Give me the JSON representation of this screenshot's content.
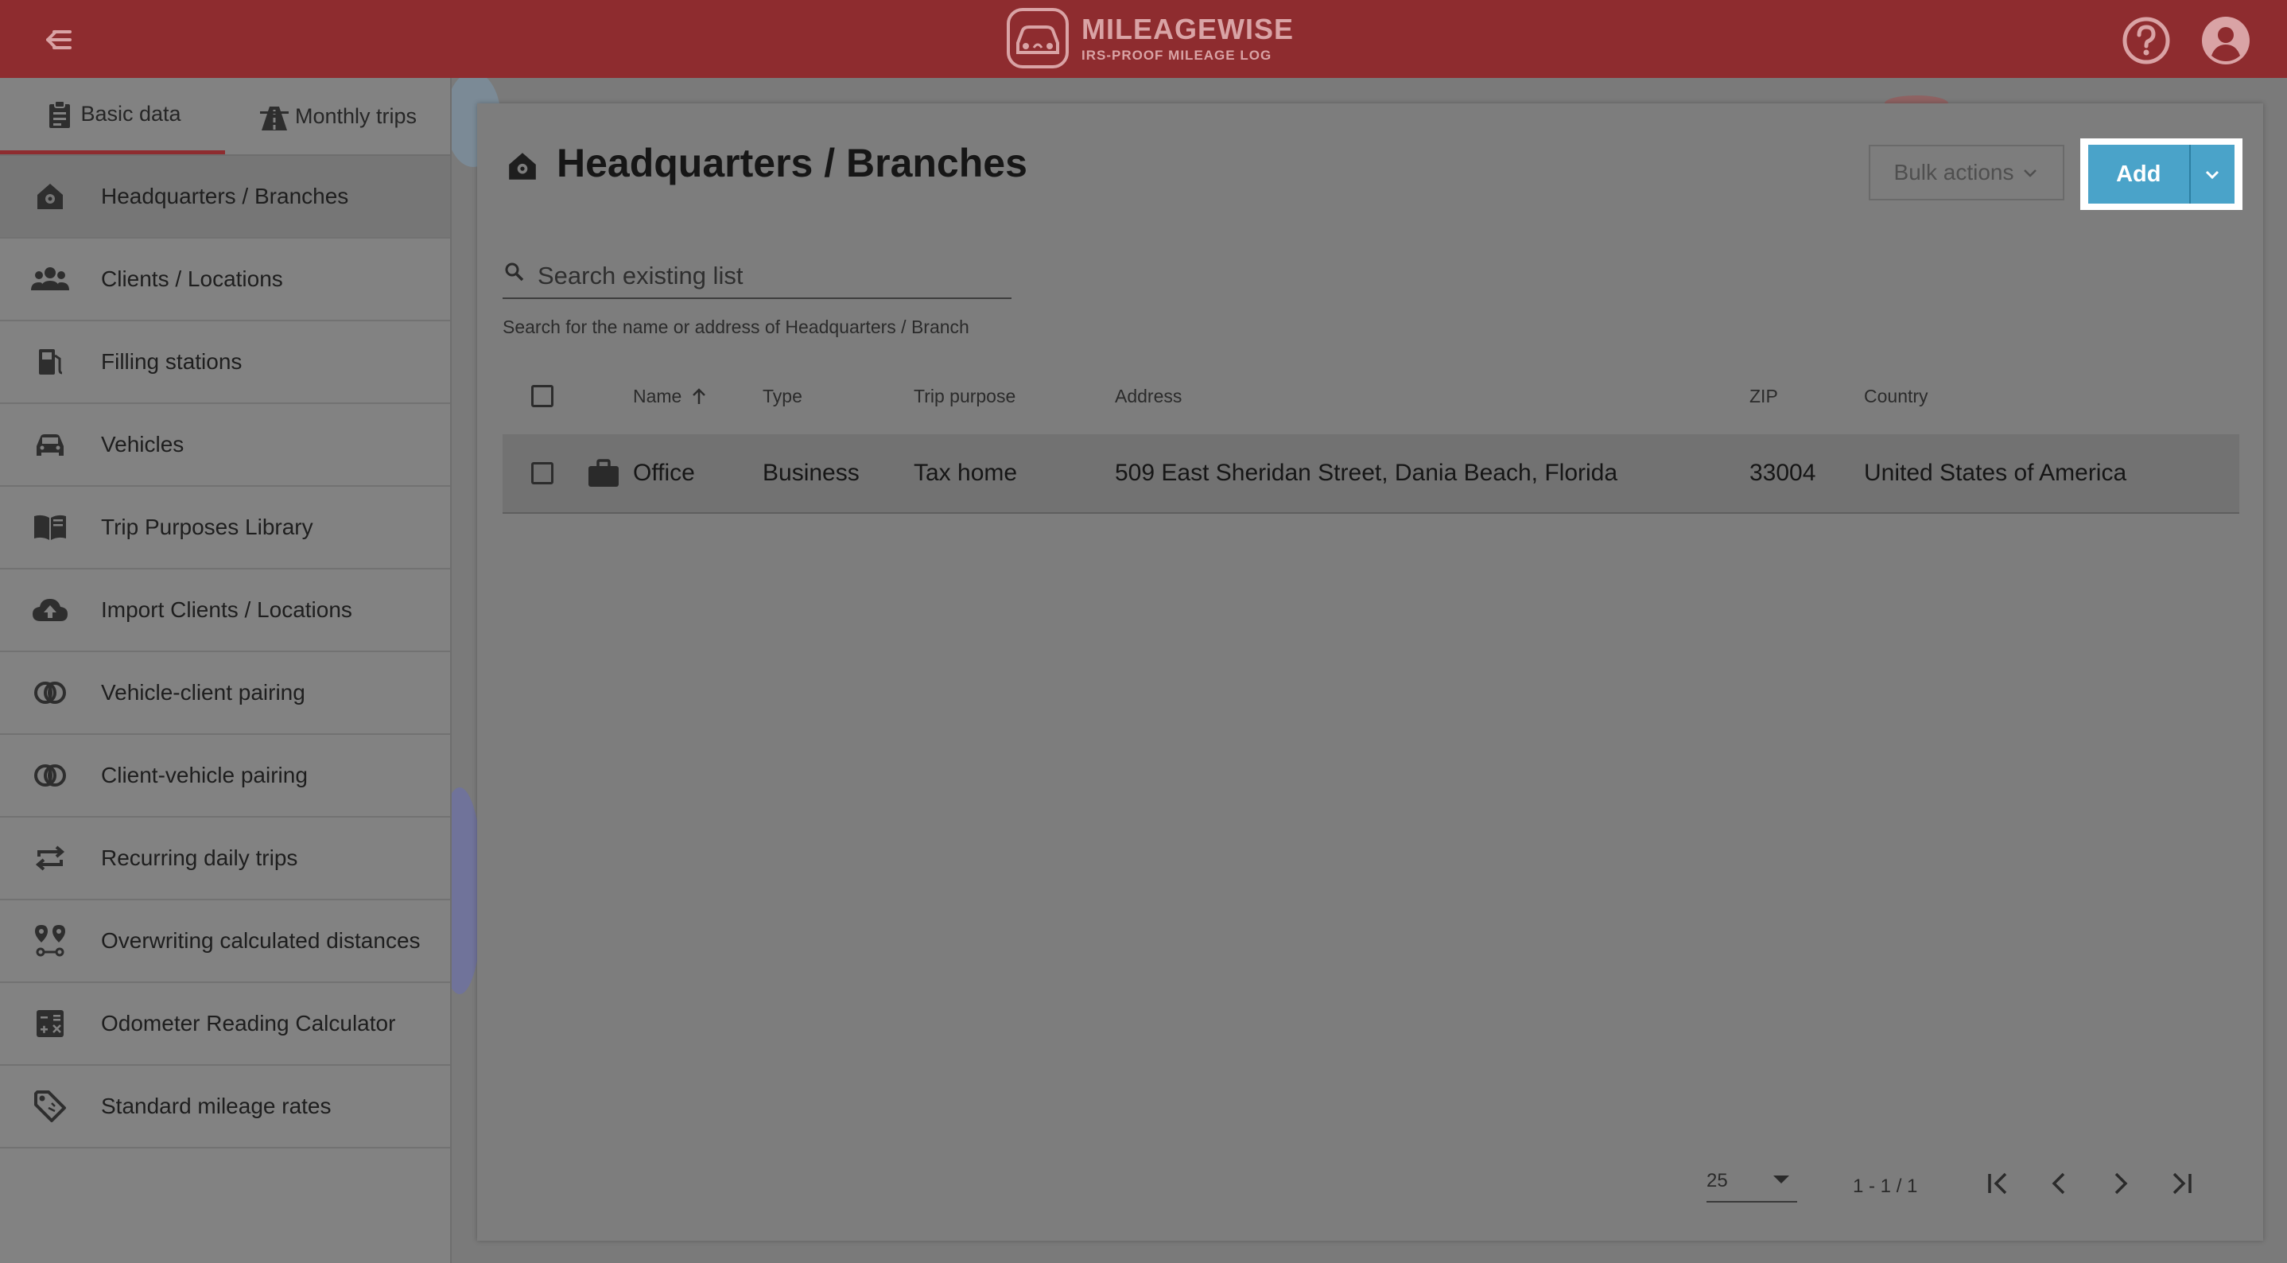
{
  "header": {
    "brand_name": "MILEAGEWISE",
    "brand_tagline": "IRS-PROOF MILEAGE LOG"
  },
  "sidebar": {
    "tabs": [
      {
        "label": "Basic data",
        "icon": "clipboard-icon",
        "active": true
      },
      {
        "label": "Monthly trips",
        "icon": "road-icon",
        "active": false
      }
    ],
    "items": [
      {
        "label": "Headquarters / Branches",
        "icon": "home-pin-icon",
        "active": true
      },
      {
        "label": "Clients / Locations",
        "icon": "people-icon"
      },
      {
        "label": "Filling stations",
        "icon": "fuel-pump-icon"
      },
      {
        "label": "Vehicles",
        "icon": "car-icon"
      },
      {
        "label": "Trip Purposes Library",
        "icon": "book-icon"
      },
      {
        "label": "Import Clients / Locations",
        "icon": "cloud-upload-icon"
      },
      {
        "label": "Vehicle-client pairing",
        "icon": "pairing-icon"
      },
      {
        "label": "Client-vehicle pairing",
        "icon": "pairing-icon"
      },
      {
        "label": "Recurring daily trips",
        "icon": "repeat-icon"
      },
      {
        "label": "Overwriting calculated distances",
        "icon": "route-pins-icon"
      },
      {
        "label": "Odometer Reading Calculator",
        "icon": "calculator-icon"
      },
      {
        "label": "Standard mileage rates",
        "icon": "tag-icon"
      }
    ]
  },
  "main": {
    "title": "Headquarters / Branches",
    "bulk_actions_label": "Bulk actions",
    "add_label": "Add",
    "search": {
      "placeholder": "Search existing list",
      "hint": "Search for the name or address of Headquarters / Branch"
    },
    "table": {
      "columns": [
        "Name",
        "Type",
        "Trip purpose",
        "Address",
        "ZIP",
        "Country"
      ],
      "sort_column": "Name",
      "sort_direction": "asc",
      "rows": [
        {
          "icon": "briefcase-icon",
          "name": "Office",
          "type": "Business",
          "trip_purpose": "Tax home",
          "address": "509 East Sheridan Street, Dania Beach, Florida",
          "zip": "33004",
          "country": "United States of America"
        }
      ]
    },
    "paginator": {
      "page_size": "25",
      "range": "1 - 1 / 1"
    }
  },
  "colors": {
    "header": "#8e2c2f",
    "accent": "#4aa3c9"
  }
}
